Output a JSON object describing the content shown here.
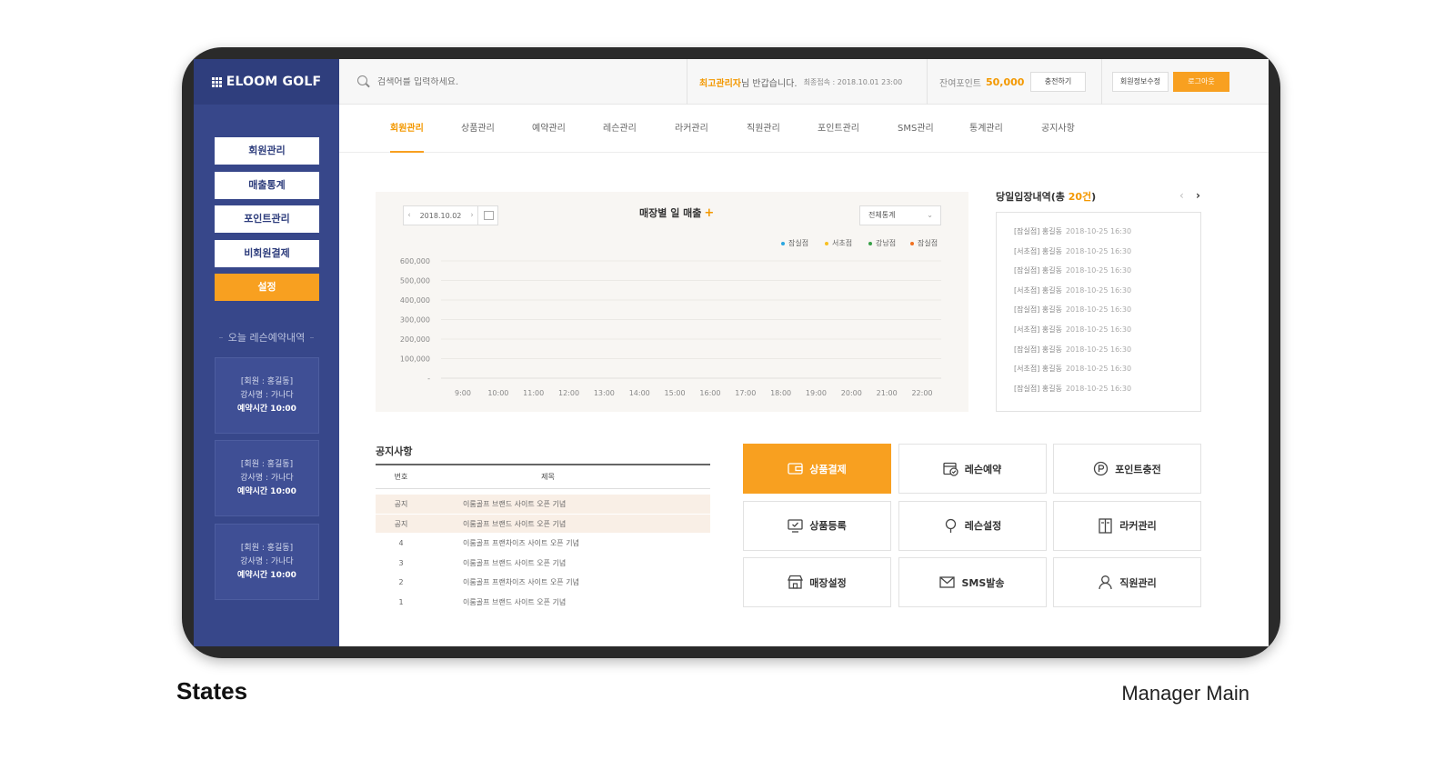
{
  "brand": "ELOOM GOLF",
  "sidebar": {
    "menu": [
      {
        "label": "회원관리",
        "active": false
      },
      {
        "label": "매출통계",
        "active": false
      },
      {
        "label": "포인트관리",
        "active": false
      },
      {
        "label": "비회원결제",
        "active": false
      },
      {
        "label": "설정",
        "active": true
      }
    ],
    "section_title": "오늘 레슨예약내역",
    "cards": [
      {
        "member": "[회원 : 홍길동]",
        "teacher": "강사명 : 가나다",
        "time": "예약시간 10:00"
      },
      {
        "member": "[회원 : 홍길동]",
        "teacher": "강사명 : 가나다",
        "time": "예약시간 10:00"
      },
      {
        "member": "[회원 : 홍길동]",
        "teacher": "강사명 : 가나다",
        "time": "예약시간 10:00"
      }
    ]
  },
  "topbar": {
    "search_placeholder": "검색어를 입력하세요.",
    "greeting_name": "최고관리자",
    "greeting_suffix": "님 반갑습니다.",
    "last_login": "최종접속 : 2018.10.01 23:00",
    "points_label": "잔여포인트",
    "points_value": "50,000",
    "charge_button": "충전하기",
    "edit_info_button": "회원정보수정",
    "logout_button": "로그아웃"
  },
  "tabs": [
    "회원관리",
    "상품관리",
    "예약관리",
    "레슨관리",
    "라커관리",
    "직원관리",
    "포인트관리",
    "SMS관리",
    "통계관리",
    "공지사항"
  ],
  "chart_panel": {
    "date": "2018.10.02",
    "title": "매장별 일 매출",
    "plus": "+",
    "select": "전체통계"
  },
  "chart_data": {
    "type": "line",
    "title": "매장별 일 매출",
    "x": [
      "9:00",
      "10:00",
      "11:00",
      "12:00",
      "13:00",
      "14:00",
      "15:00",
      "16:00",
      "17:00",
      "18:00",
      "19:00",
      "20:00",
      "21:00",
      "22:00"
    ],
    "y_ticks": [
      "600,000",
      "500,000",
      "400,000",
      "300,000",
      "200,000",
      "100,000",
      "-"
    ],
    "ylim": [
      0,
      600000
    ],
    "grid": true,
    "legend_position": "top-right",
    "series": [
      {
        "name": "잠실점",
        "color": "#2aa6e0",
        "values": []
      },
      {
        "name": "서초점",
        "color": "#f8c020",
        "values": []
      },
      {
        "name": "강남점",
        "color": "#38a048",
        "values": []
      },
      {
        "name": "잠실점",
        "color": "#f07020",
        "values": []
      }
    ]
  },
  "entry": {
    "title_prefix": "당일입장내역(총 ",
    "count": "20건",
    "title_suffix": ")",
    "rows": [
      {
        "store": "[잠실점] 홍길동",
        "time": "2018-10-25 16:30"
      },
      {
        "store": "[서초점] 홍길동",
        "time": "2018-10-25 16:30"
      },
      {
        "store": "[잠실점] 홍길동",
        "time": "2018-10-25 16:30"
      },
      {
        "store": "[서초점] 홍길동",
        "time": "2018-10-25 16:30"
      },
      {
        "store": "[잠실점] 홍길동",
        "time": "2018-10-25 16:30"
      },
      {
        "store": "[서초점] 홍길동",
        "time": "2018-10-25 16:30"
      },
      {
        "store": "[잠실점] 홍길동",
        "time": "2018-10-25 16:30"
      },
      {
        "store": "[서초점] 홍길동",
        "time": "2018-10-25 16:30"
      },
      {
        "store": "[잠실점] 홍길동",
        "time": "2018-10-25 16:30"
      }
    ]
  },
  "notice": {
    "title": "공지사항",
    "col_no": "번호",
    "col_title": "제목",
    "rows": [
      {
        "no": "공지",
        "title": "이룸골프 브랜드 사이트 오픈 기념",
        "highlight": true
      },
      {
        "no": "공지",
        "title": "이룸골프 브랜드 사이트 오픈 기념",
        "highlight": true
      },
      {
        "no": "4",
        "title": "이룸골프 프랜차이즈 사이트 오픈 기념",
        "highlight": false
      },
      {
        "no": "3",
        "title": "이룸골프 브랜드 사이트 오픈 기념",
        "highlight": false
      },
      {
        "no": "2",
        "title": "이룸골프 프랜차이즈 사이트 오픈 기념",
        "highlight": false
      },
      {
        "no": "1",
        "title": "이룸골프 브랜드 사이트 오픈 기념",
        "highlight": false
      }
    ]
  },
  "quick": [
    {
      "label": "상품결제",
      "icon": "wallet-icon",
      "active": true
    },
    {
      "label": "레슨예약",
      "icon": "calendar-check-icon",
      "active": false
    },
    {
      "label": "포인트충전",
      "icon": "point-icon",
      "active": false
    },
    {
      "label": "상품등록",
      "icon": "monitor-check-icon",
      "active": false
    },
    {
      "label": "레슨설정",
      "icon": "pin-icon",
      "active": false
    },
    {
      "label": "라커관리",
      "icon": "locker-icon",
      "active": false
    },
    {
      "label": "매장설정",
      "icon": "store-icon",
      "active": false
    },
    {
      "label": "SMS발송",
      "icon": "mail-icon",
      "active": false
    },
    {
      "label": "직원관리",
      "icon": "user-icon",
      "active": false
    }
  ],
  "footer": {
    "left": "States",
    "right": "Manager Main"
  }
}
